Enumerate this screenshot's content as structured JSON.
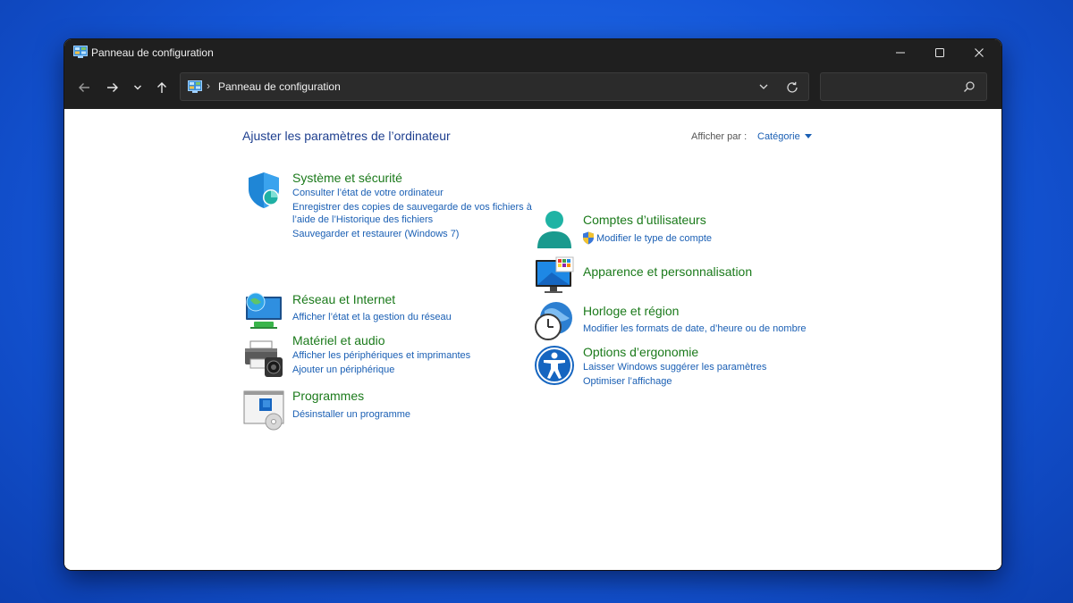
{
  "window": {
    "title": "Panneau de configuration",
    "controls": {
      "minimize": "—",
      "maximize": "☐",
      "close": "✕"
    }
  },
  "navigation": {
    "address_path": "Panneau de configuration",
    "address_separator": "›",
    "search_placeholder": ""
  },
  "content": {
    "heading": "Ajuster les paramètres de l’ordinateur",
    "view_by_label": "Afficher par :",
    "view_by_value": "Catégorie"
  },
  "left_categories": [
    {
      "title": "Système et sécurité",
      "icon": "shield-icon",
      "links": [
        "Consulter l’état de votre ordinateur",
        "Enregistrer des copies de sauvegarde de vos fichiers à",
        "l’aide de l’Historique des fichiers",
        "Sauvegarder et restaurer (Windows 7)"
      ]
    },
    {
      "title": "Réseau et Internet",
      "icon": "network-icon",
      "links": [
        "Afficher l’état et la gestion du réseau"
      ]
    },
    {
      "title": "Matériel et audio",
      "icon": "printer-icon",
      "links": [
        "Afficher les périphériques et imprimantes",
        "Ajouter un périphérique"
      ]
    },
    {
      "title": "Programmes",
      "icon": "programs-icon",
      "links": [
        "Désinstaller un programme"
      ]
    }
  ],
  "right_categories": [
    {
      "title": "Comptes d’utilisateurs",
      "icon": "user-icon",
      "links": [
        "Modifier le type de compte"
      ],
      "link_icon": "uac-shield-icon"
    },
    {
      "title": "Apparence et personnalisation",
      "icon": "monitor-icon",
      "links": []
    },
    {
      "title": "Horloge et région",
      "icon": "clock-globe-icon",
      "links": [
        "Modifier les formats de date, d’heure ou de nombre"
      ]
    },
    {
      "title": "Options d’ergonomie",
      "icon": "accessibility-icon",
      "links": [
        "Laisser Windows suggérer les paramètres",
        "Optimiser l’affichage"
      ]
    }
  ],
  "colors": {
    "title_green": "#1b7a1b",
    "link_blue": "#1a5fb4",
    "heading_blue": "#1e3f8f",
    "chrome_dark": "#1f1f1f"
  }
}
